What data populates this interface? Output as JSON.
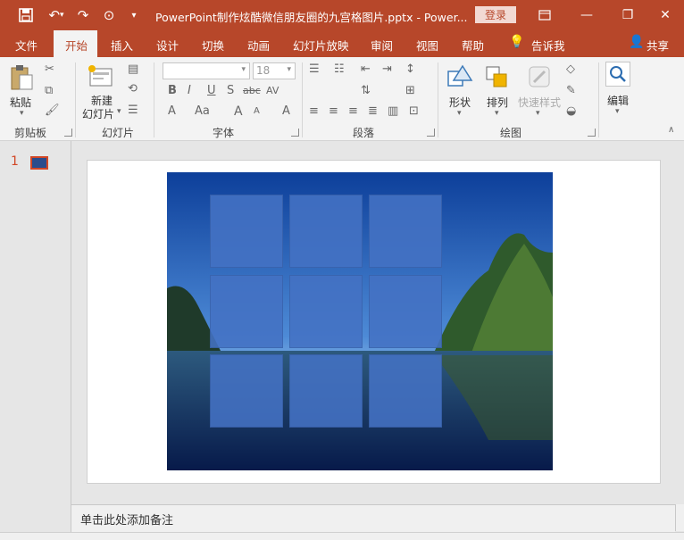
{
  "window": {
    "title": "PowerPoint制作炫酷微信朋友圈的九宫格图片.pptx  -  Power...",
    "login_label": "登录",
    "minimize_glyph": "—",
    "restore_glyph": "❐",
    "close_glyph": "✕",
    "save_glyph": "💾",
    "undo_glyph": "↶",
    "redo_glyph": "↷",
    "present_glyph": "⊙",
    "qat_more_glyph": "▾"
  },
  "tabs": [
    "文件",
    "开始",
    "插入",
    "设计",
    "切换",
    "动画",
    "幻灯片放映",
    "审阅",
    "视图",
    "帮助"
  ],
  "tell_me": "告诉我",
  "share": "共享",
  "ribbon": {
    "clipboard": {
      "label": "剪贴板",
      "paste": "粘贴"
    },
    "slides": {
      "label": "幻灯片",
      "new_slide_line1": "新建",
      "new_slide_line2": "幻灯片"
    },
    "font": {
      "label": "字体",
      "font_size": "18",
      "bold": "B",
      "italic": "I",
      "underline": "U",
      "shadow": "S",
      "strike": "abc",
      "spacing": "AV",
      "font_color": "A",
      "case": "Aa",
      "grow": "A",
      "shrink": "A",
      "clear": "A"
    },
    "paragraph": {
      "label": "段落"
    },
    "drawing": {
      "label": "绘图",
      "shapes": "形状",
      "arrange": "排列",
      "quick_styles": "快速样式"
    },
    "editing": {
      "label": "编辑"
    }
  },
  "slide_number": "1",
  "notes_placeholder": "单击此处添加备注",
  "colors": {
    "accent": "#b7472a",
    "tile": "#4472c4"
  }
}
